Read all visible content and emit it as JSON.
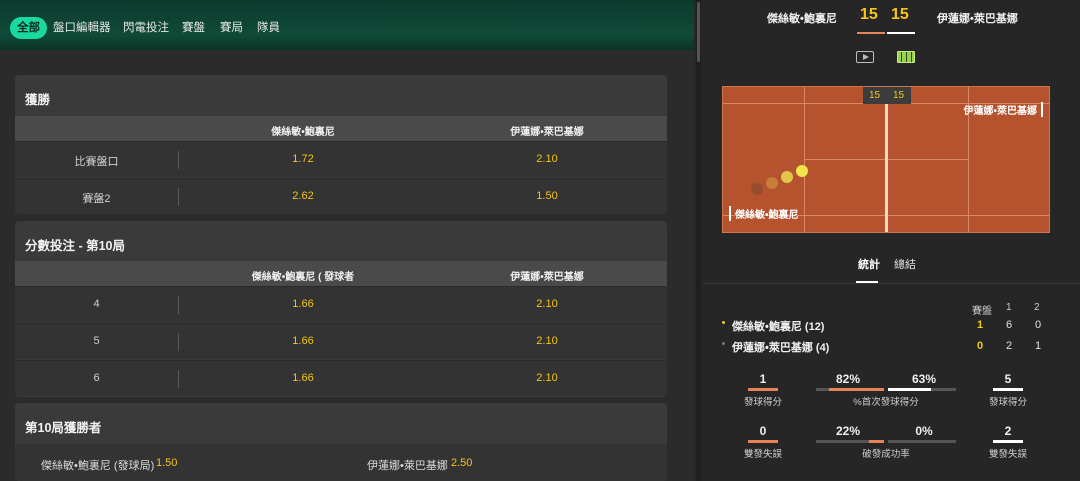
{
  "nav": {
    "items": [
      "全部",
      "盤口編輯器",
      "閃電投注",
      "賽盤",
      "賽局",
      "隊員"
    ]
  },
  "card1": {
    "title": "獲勝",
    "col1": "傑絲敏•鮑裏尼",
    "col2": "伊蓮娜•萊巴基娜",
    "rows": [
      {
        "label": "比賽盤口",
        "o1": "1.72",
        "o2": "2.10"
      },
      {
        "label": "賽盤2",
        "o1": "2.62",
        "o2": "1.50"
      }
    ]
  },
  "card2": {
    "title": "分數投注 - 第10局",
    "col1": "傑絲敏•鮑裏尼 ( 發球者",
    "col2": "伊蓮娜•萊巴基娜",
    "rows": [
      {
        "label": "4",
        "o1": "1.66",
        "o2": "2.10"
      },
      {
        "label": "5",
        "o1": "1.66",
        "o2": "2.10"
      },
      {
        "label": "6",
        "o1": "1.66",
        "o2": "2.10"
      }
    ]
  },
  "card3": {
    "title": "第10局獲勝者",
    "left_label": "傑絲敏•鮑裏尼 (發球局)",
    "left_odd": "1.50",
    "right_label": "伊蓮娜•萊巴基娜",
    "right_odd": "2.50"
  },
  "scoreboard": {
    "p1": "傑絲敏•鮑裏尼",
    "p2": "伊蓮娜•萊巴基娜",
    "s1": "15",
    "s2": "15",
    "court_s1": "15",
    "court_s2": "15",
    "court_p1": "傑絲敏•鮑裏尼",
    "court_p2": "伊蓮娜•萊巴基娜"
  },
  "tabs": {
    "stats": "統計",
    "summary": "總結"
  },
  "sets": {
    "header": [
      "賽盤",
      "1",
      "2"
    ],
    "players": [
      {
        "name": "傑絲敏•鮑裏尼 (12)",
        "sets": "1",
        "s1": "6",
        "s2": "0"
      },
      {
        "name": "伊蓮娜•萊巴基娜 (4)",
        "sets": "0",
        "s1": "2",
        "s2": "1"
      }
    ]
  },
  "stats": {
    "aces": {
      "p1": "1",
      "p2": "5",
      "label_l": "發球得分",
      "label_r": "發球得分"
    },
    "first_serve": {
      "p1": "82%",
      "p2": "63%",
      "label": "%首次發球得分"
    },
    "double_faults": {
      "p1": "0",
      "p2": "2",
      "label_l": "雙發失誤",
      "label_r": "雙發失誤"
    },
    "break_points": {
      "p1": "22%",
      "p2": "0%",
      "label": "破發成功率"
    }
  },
  "colors": {
    "accent": "#1ad9a0",
    "odds": "#f5c518",
    "court": "#b5532f",
    "p1_bar": "#e8845a",
    "p2_bar": "#ffffff"
  },
  "icons": {
    "video": "video-icon",
    "court": "court-icon"
  }
}
